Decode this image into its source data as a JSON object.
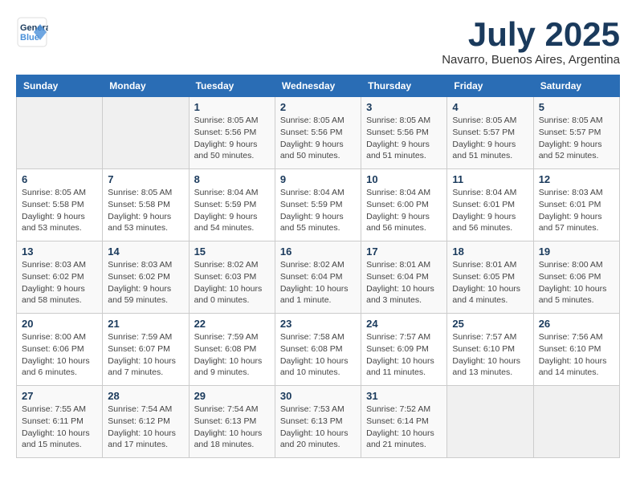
{
  "header": {
    "logo_line1": "General",
    "logo_line2": "Blue",
    "month_year": "July 2025",
    "location": "Navarro, Buenos Aires, Argentina"
  },
  "days_of_week": [
    "Sunday",
    "Monday",
    "Tuesday",
    "Wednesday",
    "Thursday",
    "Friday",
    "Saturday"
  ],
  "weeks": [
    [
      {
        "day": "",
        "info": ""
      },
      {
        "day": "",
        "info": ""
      },
      {
        "day": "1",
        "info": "Sunrise: 8:05 AM\nSunset: 5:56 PM\nDaylight: 9 hours and 50 minutes."
      },
      {
        "day": "2",
        "info": "Sunrise: 8:05 AM\nSunset: 5:56 PM\nDaylight: 9 hours and 50 minutes."
      },
      {
        "day": "3",
        "info": "Sunrise: 8:05 AM\nSunset: 5:56 PM\nDaylight: 9 hours and 51 minutes."
      },
      {
        "day": "4",
        "info": "Sunrise: 8:05 AM\nSunset: 5:57 PM\nDaylight: 9 hours and 51 minutes."
      },
      {
        "day": "5",
        "info": "Sunrise: 8:05 AM\nSunset: 5:57 PM\nDaylight: 9 hours and 52 minutes."
      }
    ],
    [
      {
        "day": "6",
        "info": "Sunrise: 8:05 AM\nSunset: 5:58 PM\nDaylight: 9 hours and 53 minutes."
      },
      {
        "day": "7",
        "info": "Sunrise: 8:05 AM\nSunset: 5:58 PM\nDaylight: 9 hours and 53 minutes."
      },
      {
        "day": "8",
        "info": "Sunrise: 8:04 AM\nSunset: 5:59 PM\nDaylight: 9 hours and 54 minutes."
      },
      {
        "day": "9",
        "info": "Sunrise: 8:04 AM\nSunset: 5:59 PM\nDaylight: 9 hours and 55 minutes."
      },
      {
        "day": "10",
        "info": "Sunrise: 8:04 AM\nSunset: 6:00 PM\nDaylight: 9 hours and 56 minutes."
      },
      {
        "day": "11",
        "info": "Sunrise: 8:04 AM\nSunset: 6:01 PM\nDaylight: 9 hours and 56 minutes."
      },
      {
        "day": "12",
        "info": "Sunrise: 8:03 AM\nSunset: 6:01 PM\nDaylight: 9 hours and 57 minutes."
      }
    ],
    [
      {
        "day": "13",
        "info": "Sunrise: 8:03 AM\nSunset: 6:02 PM\nDaylight: 9 hours and 58 minutes."
      },
      {
        "day": "14",
        "info": "Sunrise: 8:03 AM\nSunset: 6:02 PM\nDaylight: 9 hours and 59 minutes."
      },
      {
        "day": "15",
        "info": "Sunrise: 8:02 AM\nSunset: 6:03 PM\nDaylight: 10 hours and 0 minutes."
      },
      {
        "day": "16",
        "info": "Sunrise: 8:02 AM\nSunset: 6:04 PM\nDaylight: 10 hours and 1 minute."
      },
      {
        "day": "17",
        "info": "Sunrise: 8:01 AM\nSunset: 6:04 PM\nDaylight: 10 hours and 3 minutes."
      },
      {
        "day": "18",
        "info": "Sunrise: 8:01 AM\nSunset: 6:05 PM\nDaylight: 10 hours and 4 minutes."
      },
      {
        "day": "19",
        "info": "Sunrise: 8:00 AM\nSunset: 6:06 PM\nDaylight: 10 hours and 5 minutes."
      }
    ],
    [
      {
        "day": "20",
        "info": "Sunrise: 8:00 AM\nSunset: 6:06 PM\nDaylight: 10 hours and 6 minutes."
      },
      {
        "day": "21",
        "info": "Sunrise: 7:59 AM\nSunset: 6:07 PM\nDaylight: 10 hours and 7 minutes."
      },
      {
        "day": "22",
        "info": "Sunrise: 7:59 AM\nSunset: 6:08 PM\nDaylight: 10 hours and 9 minutes."
      },
      {
        "day": "23",
        "info": "Sunrise: 7:58 AM\nSunset: 6:08 PM\nDaylight: 10 hours and 10 minutes."
      },
      {
        "day": "24",
        "info": "Sunrise: 7:57 AM\nSunset: 6:09 PM\nDaylight: 10 hours and 11 minutes."
      },
      {
        "day": "25",
        "info": "Sunrise: 7:57 AM\nSunset: 6:10 PM\nDaylight: 10 hours and 13 minutes."
      },
      {
        "day": "26",
        "info": "Sunrise: 7:56 AM\nSunset: 6:10 PM\nDaylight: 10 hours and 14 minutes."
      }
    ],
    [
      {
        "day": "27",
        "info": "Sunrise: 7:55 AM\nSunset: 6:11 PM\nDaylight: 10 hours and 15 minutes."
      },
      {
        "day": "28",
        "info": "Sunrise: 7:54 AM\nSunset: 6:12 PM\nDaylight: 10 hours and 17 minutes."
      },
      {
        "day": "29",
        "info": "Sunrise: 7:54 AM\nSunset: 6:13 PM\nDaylight: 10 hours and 18 minutes."
      },
      {
        "day": "30",
        "info": "Sunrise: 7:53 AM\nSunset: 6:13 PM\nDaylight: 10 hours and 20 minutes."
      },
      {
        "day": "31",
        "info": "Sunrise: 7:52 AM\nSunset: 6:14 PM\nDaylight: 10 hours and 21 minutes."
      },
      {
        "day": "",
        "info": ""
      },
      {
        "day": "",
        "info": ""
      }
    ]
  ]
}
